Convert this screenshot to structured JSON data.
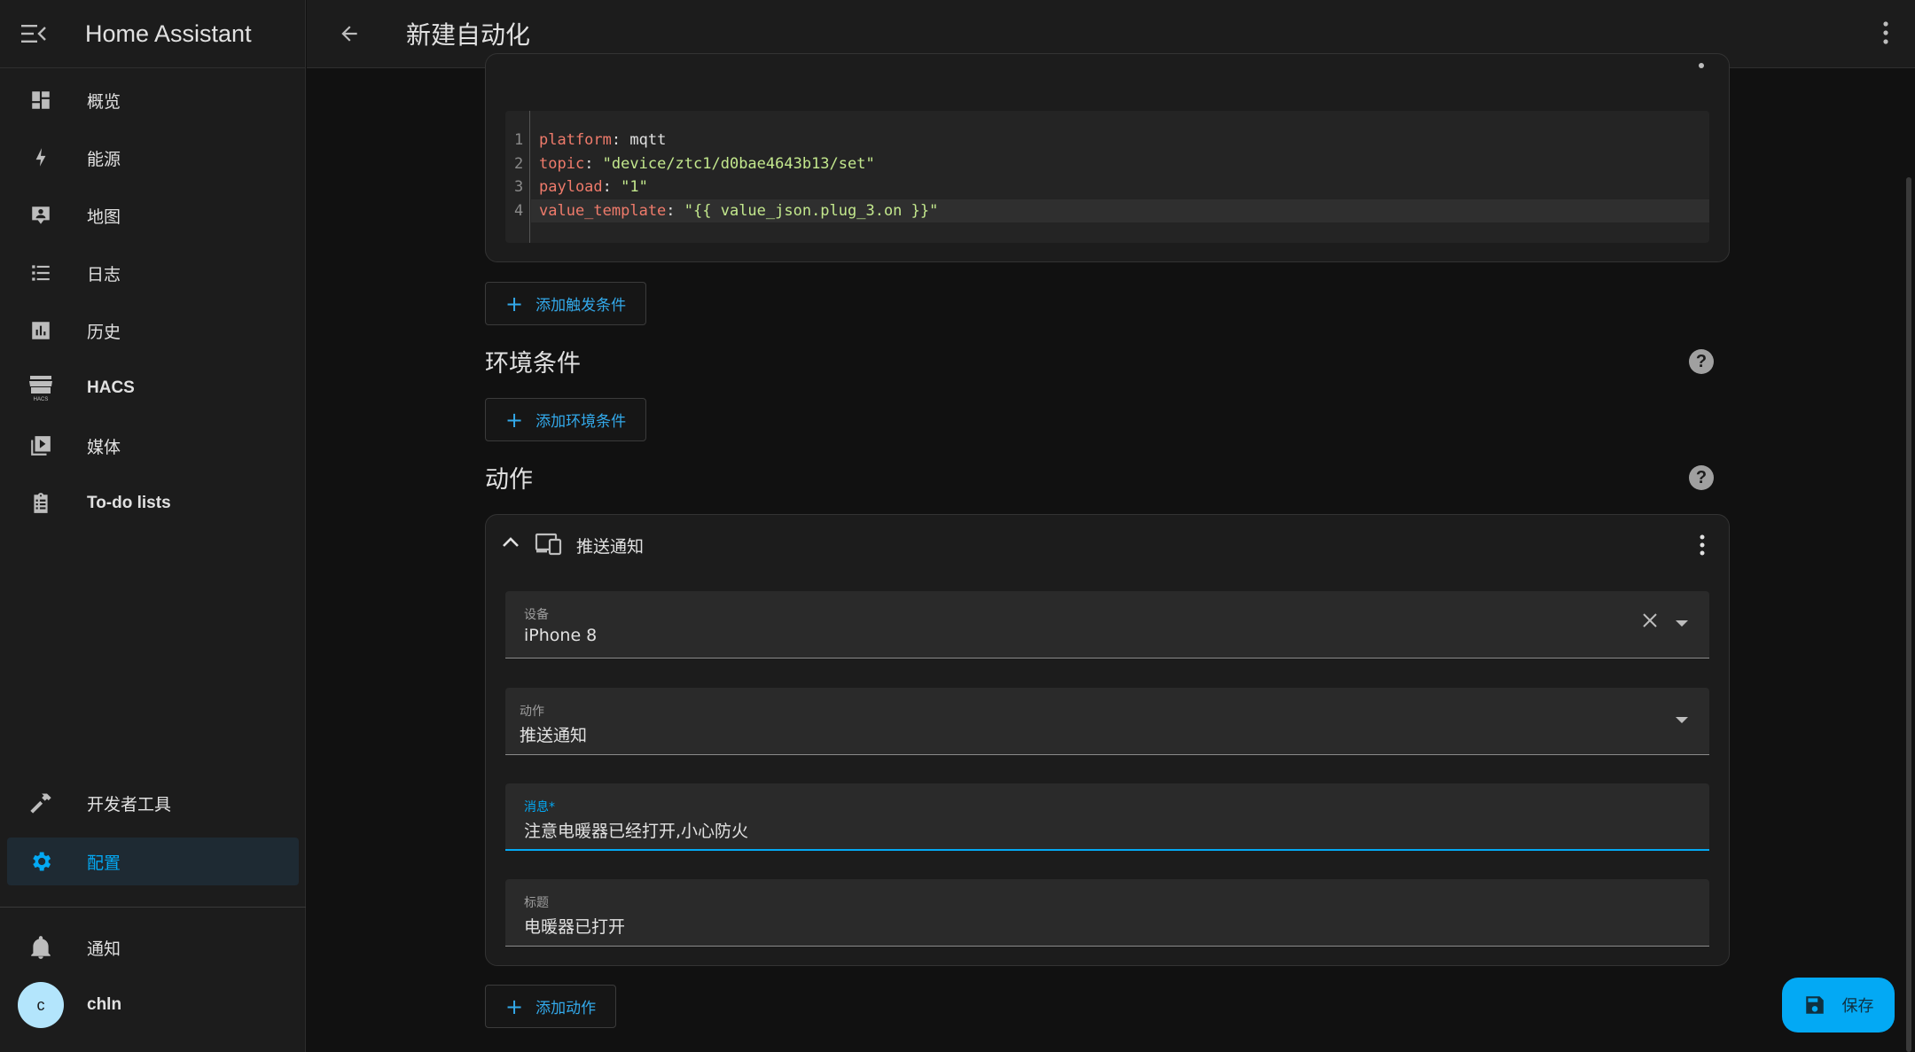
{
  "app": {
    "title": "Home Assistant"
  },
  "sidebar": {
    "items": [
      {
        "label": "概览",
        "icon": "dashboard-icon"
      },
      {
        "label": "能源",
        "icon": "lightning-icon"
      },
      {
        "label": "地图",
        "icon": "map-account-icon"
      },
      {
        "label": "日志",
        "icon": "list-icon"
      },
      {
        "label": "历史",
        "icon": "chart-box-icon"
      },
      {
        "label": "HACS",
        "icon": "hacs-store-icon"
      },
      {
        "label": "媒体",
        "icon": "media-play-icon"
      },
      {
        "label": "To-do lists",
        "icon": "clipboard-list-icon"
      }
    ],
    "dev_tools": {
      "label": "开发者工具",
      "icon": "hammer-icon"
    },
    "settings": {
      "label": "配置",
      "icon": "gear-icon"
    },
    "notifications": {
      "label": "通知",
      "icon": "bell-icon"
    },
    "user": {
      "initial": "c",
      "name": "chln"
    }
  },
  "topbar": {
    "title": "新建自动化"
  },
  "trigger": {
    "code_lines": [
      {
        "n": "1",
        "key": "platform",
        "val": "mqtt",
        "type": "plain"
      },
      {
        "n": "2",
        "key": "topic",
        "val": "\"device/ztc1/d0bae4643b13/set\"",
        "type": "string"
      },
      {
        "n": "3",
        "key": "payload",
        "val": "\"1\"",
        "type": "string"
      },
      {
        "n": "4",
        "key": "value_template",
        "val": "\"{{ value_json.plug_3.on }}\"",
        "type": "string"
      }
    ],
    "add_label": "添加触发条件"
  },
  "conditions": {
    "title": "环境条件",
    "add_label": "添加环境条件"
  },
  "actions": {
    "title": "动作",
    "card_title": "推送通知",
    "fields": {
      "device": {
        "label": "设备",
        "value": "iPhone 8"
      },
      "action": {
        "label": "动作",
        "value": "推送通知"
      },
      "message": {
        "label": "消息*",
        "value": "注意电暖器已经打开,小心防火"
      },
      "title": {
        "label": "标题",
        "value": "电暖器已打开"
      }
    },
    "add_label": "添加动作"
  },
  "save": {
    "label": "保存"
  },
  "colors": {
    "accent": "#03a9f4",
    "background": "#111111",
    "card": "#1c1c1c"
  }
}
